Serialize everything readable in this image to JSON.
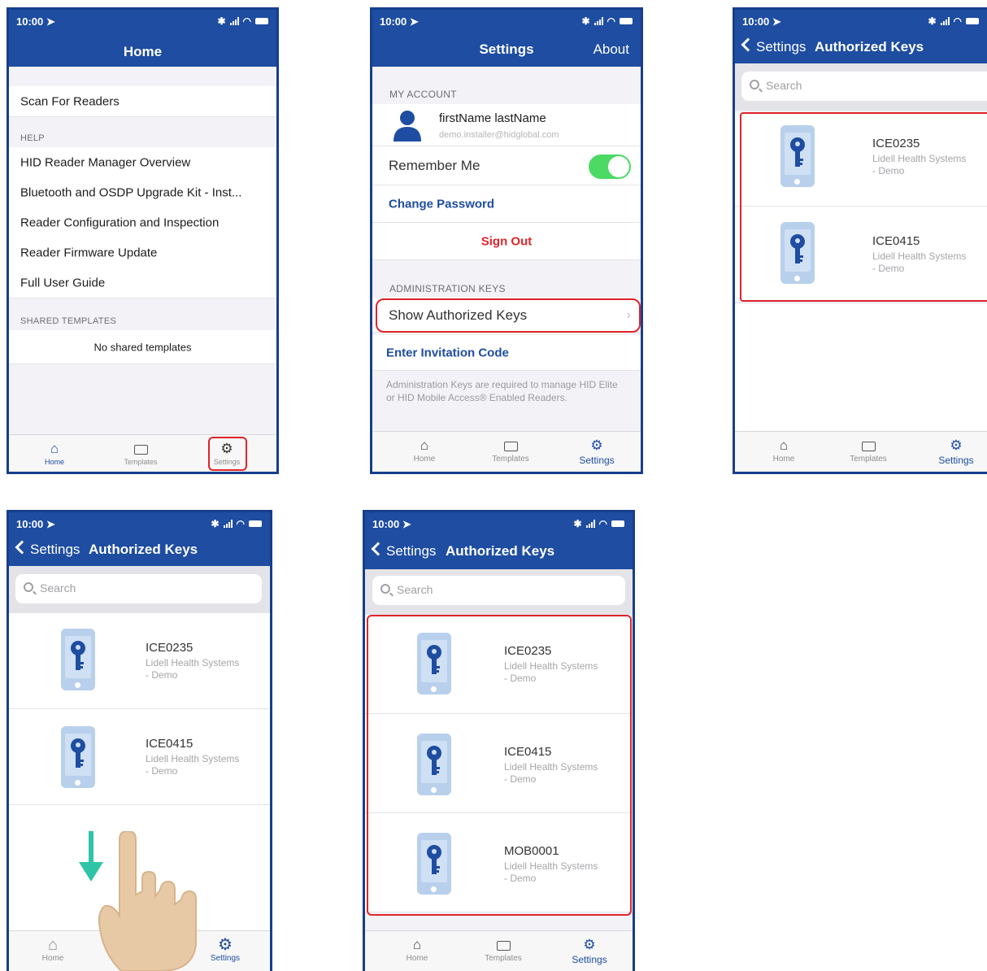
{
  "colors": {
    "brand": "#1e4da1",
    "highlight": "#e0242a",
    "toggle_on": "#4cd964",
    "signout": "#e0242a",
    "link": "#1e4da1"
  },
  "status": {
    "time": "10:00",
    "location_icon": "location-arrow-icon",
    "bluetooth_icon": "bluetooth-icon",
    "signal_icon": "signal-icon",
    "wifi_icon": "wifi-icon",
    "battery_icon": "battery-icon"
  },
  "tabs": {
    "home": "Home",
    "templates": "Templates",
    "settings": "Settings"
  },
  "screen1": {
    "title": "Home",
    "scan": "Scan For Readers",
    "help_header": "HELP",
    "help_items": [
      "HID Reader Manager Overview",
      "Bluetooth and OSDP Upgrade Kit - Inst...",
      "Reader Configuration and Inspection",
      "Reader Firmware Update",
      "Full User Guide"
    ],
    "templates_header": "SHARED TEMPLATES",
    "no_templates": "No shared templates"
  },
  "screen2": {
    "title": "Settings",
    "about": "About",
    "account_header": "MY ACCOUNT",
    "user_name": "firstName lastName",
    "user_email": "demo.installer@hidglobal.com",
    "remember_me": "Remember Me",
    "remember_me_on": true,
    "change_password": "Change Password",
    "sign_out": "Sign Out",
    "admin_header": "ADMINISTRATION KEYS",
    "show_keys": "Show Authorized Keys",
    "invitation": "Enter Invitation Code",
    "admin_note": "Administration Keys are required to manage HID Elite or HID Mobile Access® Enabled Readers."
  },
  "keys_screen": {
    "back": "Settings",
    "title": "Authorized Keys",
    "search_placeholder": "Search"
  },
  "keys": [
    {
      "name": "ICE0235",
      "org1": "Lidell Health Systems",
      "org2": "- Demo"
    },
    {
      "name": "ICE0415",
      "org1": "Lidell Health Systems",
      "org2": "- Demo"
    },
    {
      "name": "MOB0001",
      "org1": "Lidell Health Systems",
      "org2": "- Demo"
    }
  ]
}
